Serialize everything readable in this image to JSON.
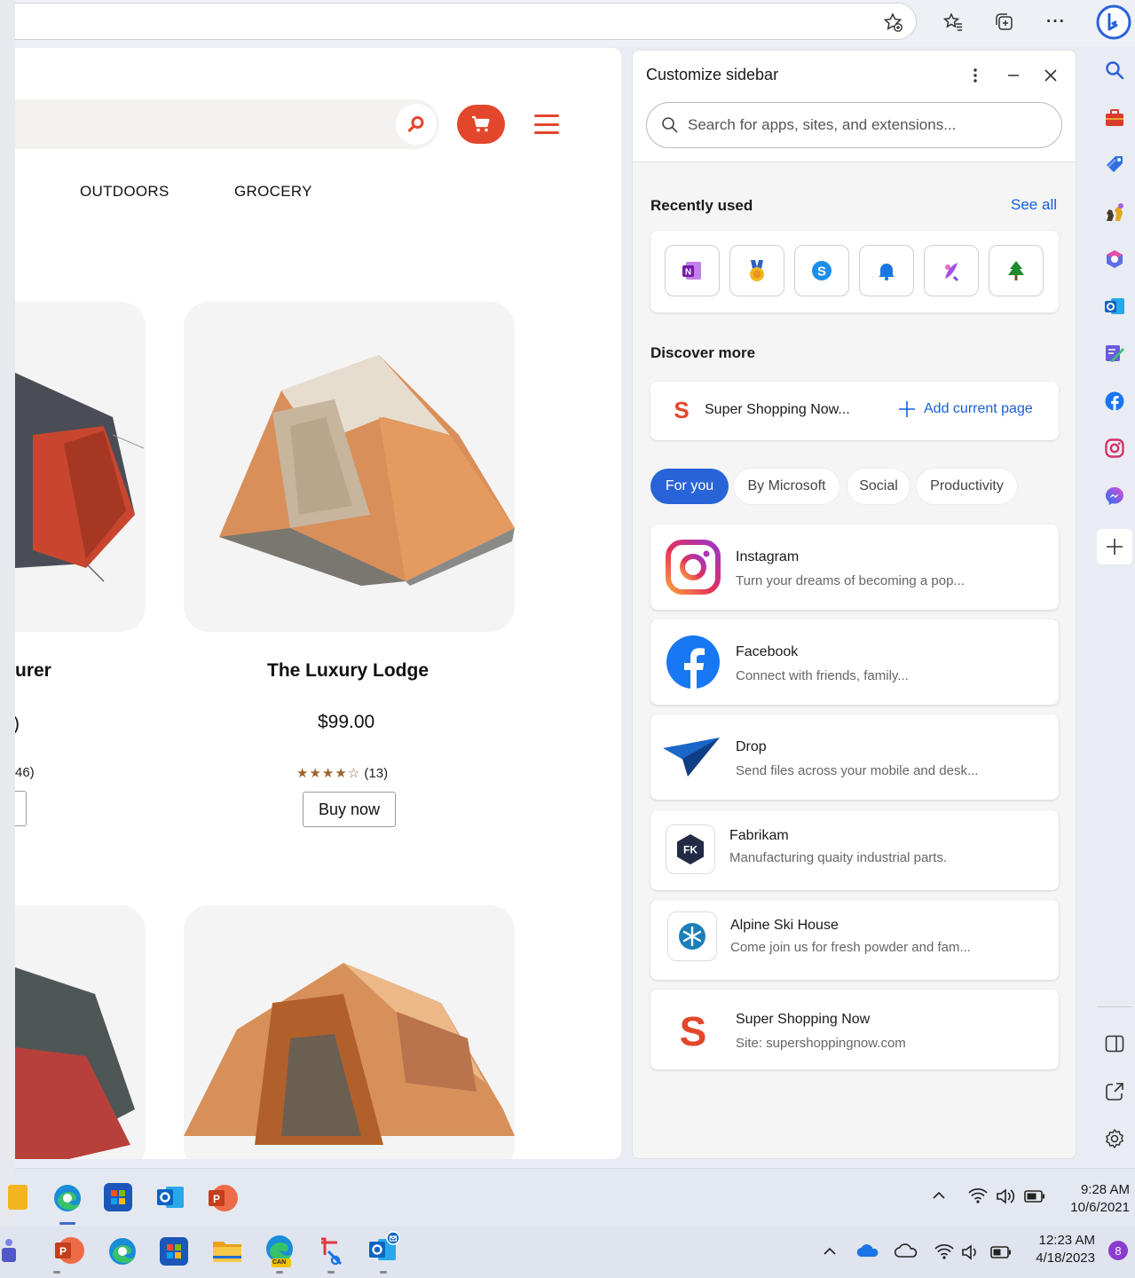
{
  "browser": {
    "toolbar_icons": [
      "favorite-add-icon",
      "favorites-icon",
      "collections-icon",
      "more-icon",
      "bing-icon"
    ],
    "more_label": "···"
  },
  "site": {
    "nav": [
      "OUTDOORS",
      "GROCERY"
    ],
    "products": [
      {
        "title": "urer",
        "price": ")",
        "rating_count": "46)",
        "buy_label": ""
      },
      {
        "title": "The Luxury Lodge",
        "price": "$99.00",
        "stars": "★★★★☆",
        "rating_count": "(13)",
        "buy_label": "Buy now"
      }
    ],
    "brand_color": "#e2472b"
  },
  "panel": {
    "title": "Customize sidebar",
    "search_placeholder": "Search for apps, sites, and extensions...",
    "recently_used_title": "Recently used",
    "see_all": "See all",
    "recent_apps": [
      "onenote-icon",
      "rewards-icon",
      "skype-icon",
      "notifications-icon",
      "designer-icon",
      "tree-icon"
    ],
    "discover_title": "Discover more",
    "current_site": "Super Shopping Now...",
    "add_current_page": "Add current page",
    "chips": [
      "For you",
      "By Microsoft",
      "Social",
      "Productivity"
    ],
    "apps": [
      {
        "name": "Instagram",
        "desc": "Turn your dreams of becoming a pop..."
      },
      {
        "name": "Facebook",
        "desc": "Connect with friends, family..."
      },
      {
        "name": "Drop",
        "desc": "Send files across your mobile and desk..."
      },
      {
        "name": "Fabrikam",
        "desc": "Manufacturing quaity industrial parts.",
        "icon_text": "FK"
      },
      {
        "name": "Alpine Ski House",
        "desc": "Come join us for fresh powder and fam..."
      },
      {
        "name": "Super Shopping Now",
        "desc": "Site: supershoppingnow.com"
      }
    ],
    "accent": "#2864d8"
  },
  "taskbar1": {
    "time": "9:28 AM",
    "date": "10/6/2021"
  },
  "taskbar2": {
    "time": "12:23 AM",
    "date": "4/18/2023",
    "notification_count": "8",
    "can_badge": "CAN"
  }
}
